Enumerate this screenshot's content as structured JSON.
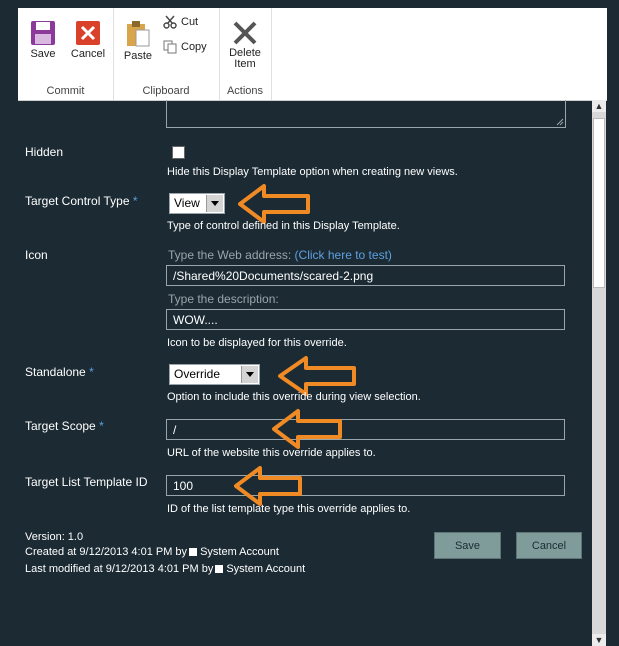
{
  "ribbon": {
    "commit": {
      "label": "Commit",
      "save": "Save",
      "cancel": "Cancel"
    },
    "clipboard": {
      "label": "Clipboard",
      "paste": "Paste",
      "cut": "Cut",
      "copy": "Copy"
    },
    "actions": {
      "label": "Actions",
      "delete_line1": "Delete",
      "delete_line2": "Item"
    }
  },
  "form": {
    "hidden": {
      "label": "Hidden",
      "checked": false,
      "desc": "Hide this Display Template option when creating new views."
    },
    "target_control_type": {
      "label": "Target Control Type",
      "required": "*",
      "value": "View",
      "desc": "Type of control defined in this Display Template."
    },
    "icon": {
      "label": "Icon",
      "web_hint": "Type the Web address:",
      "test_link_open": "(",
      "test_link": "Click here to test",
      "test_link_close": ")",
      "url_value": "/Shared%20Documents/scared-2.png",
      "desc_hint": "Type the description:",
      "desc_value": "WOW....",
      "desc": "Icon to be displayed for this override."
    },
    "standalone": {
      "label": "Standalone",
      "required": "*",
      "value": "Override",
      "desc": "Option to include this override during view selection."
    },
    "target_scope": {
      "label": "Target Scope",
      "required": "*",
      "value": "/",
      "desc": "URL of the website this override applies to."
    },
    "target_list_template_id": {
      "label": "Target List Template ID",
      "value": "100",
      "desc": "ID of the list template type this override applies to."
    }
  },
  "footer": {
    "version": "Version: 1.0",
    "created": "Created at 9/12/2013 4:01 PM  by",
    "created_by": "System Account",
    "modified": "Last modified at 9/12/2013 4:01 PM  by",
    "modified_by": "System Account",
    "save": "Save",
    "cancel": "Cancel"
  },
  "colors": {
    "background": "#1b2a33",
    "accent": "#5ea0e0",
    "arrow": "#f08a24",
    "button": "#7f9c9a"
  }
}
